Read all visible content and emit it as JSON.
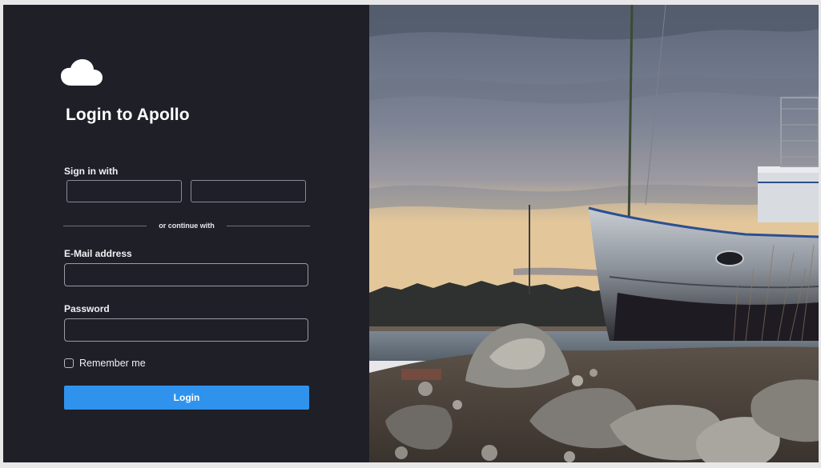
{
  "app": {
    "title": "Login to Apollo",
    "logo_icon": "cloud-icon"
  },
  "sso": {
    "label": "Sign in with",
    "providers": [
      "",
      ""
    ]
  },
  "divider": {
    "text": "or continue with"
  },
  "form": {
    "email_label": "E-Mail address",
    "email_value": "",
    "password_label": "Password",
    "password_value": "",
    "remember_label": "Remember me",
    "remember_checked": false,
    "login_label": "Login"
  },
  "colors": {
    "panel_bg": "#1f1f28",
    "accent": "#2f93ee"
  },
  "hero": {
    "image_desc_icon": "landscape-photo"
  }
}
